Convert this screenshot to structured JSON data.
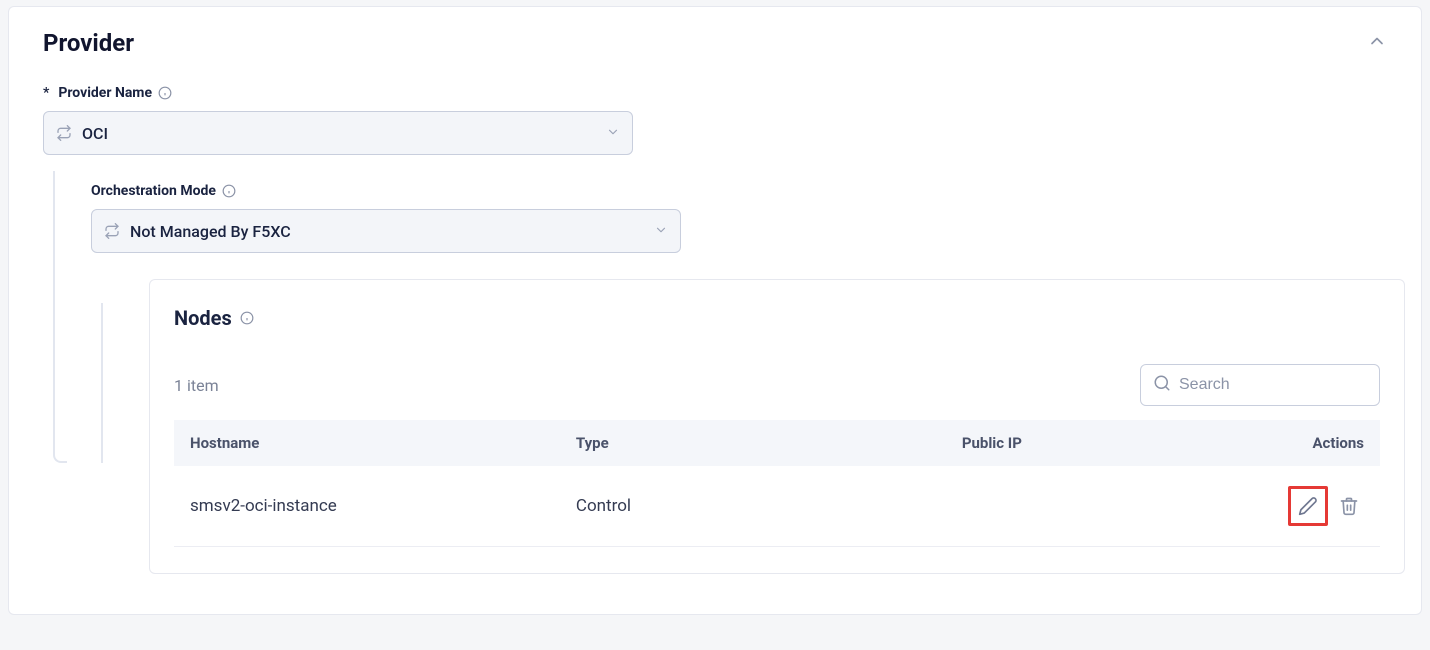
{
  "panel": {
    "title": "Provider"
  },
  "provider_name": {
    "required_mark": "*",
    "label": "Provider Name",
    "value": "OCI"
  },
  "orchestration_mode": {
    "label": "Orchestration Mode",
    "value": "Not Managed By F5XC"
  },
  "nodes": {
    "title": "Nodes",
    "item_count": "1 item",
    "search_placeholder": "Search",
    "columns": {
      "hostname": "Hostname",
      "type": "Type",
      "public_ip": "Public IP",
      "actions": "Actions"
    },
    "rows": [
      {
        "hostname": "smsv2-oci-instance",
        "type": "Control",
        "public_ip": ""
      }
    ]
  }
}
